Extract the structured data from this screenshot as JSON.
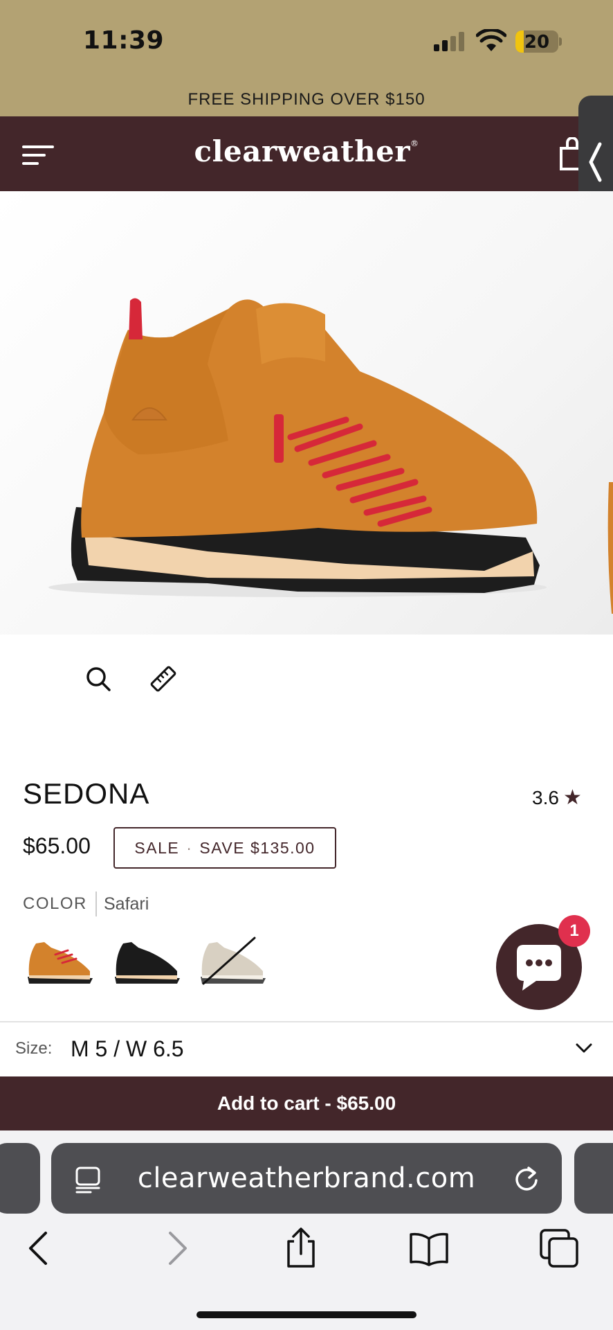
{
  "status_bar": {
    "time": "11:39",
    "battery": "20",
    "battery_level": 0.2
  },
  "promo": {
    "text": "FREE SHIPPING OVER $150"
  },
  "header": {
    "brand": "clearweather",
    "brand_mark": "®"
  },
  "product": {
    "title": "SEDONA",
    "rating": "3.6",
    "rating_star": "★",
    "price": "$65.00",
    "sale_label": "SALE",
    "sale_separator": "·",
    "sale_savings": "SAVE $135.00",
    "color_label": "COLOR",
    "color_value": "Safari",
    "swatch_sold_out": [
      false,
      false,
      true
    ]
  },
  "chat": {
    "badge_count": "1"
  },
  "size": {
    "label": "Size:",
    "value": "M 5 / W 6.5"
  },
  "cart": {
    "button_label": "Add to cart  - $65.00"
  },
  "browser": {
    "url": "clearweatherbrand.com"
  },
  "colors": {
    "brand": "#43262a",
    "promo_bg": "#b3a273",
    "badge": "#e0304e",
    "shoe": "#d3822c",
    "laces": "#d62839"
  }
}
